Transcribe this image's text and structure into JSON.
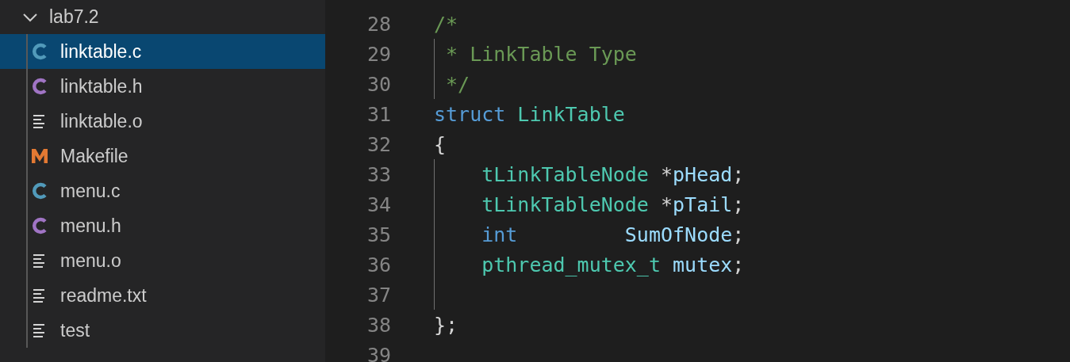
{
  "sidebar": {
    "folder": {
      "name": "lab7.2",
      "expanded": true
    },
    "items": [
      {
        "name": "linktable.c",
        "kind": "c",
        "selected": true
      },
      {
        "name": "linktable.h",
        "kind": "h",
        "selected": false
      },
      {
        "name": "linktable.o",
        "kind": "text",
        "selected": false
      },
      {
        "name": "Makefile",
        "kind": "make",
        "selected": false
      },
      {
        "name": "menu.c",
        "kind": "c",
        "selected": false
      },
      {
        "name": "menu.h",
        "kind": "h",
        "selected": false
      },
      {
        "name": "menu.o",
        "kind": "text",
        "selected": false
      },
      {
        "name": "readme.txt",
        "kind": "text",
        "selected": false
      },
      {
        "name": "test",
        "kind": "text",
        "selected": false
      }
    ]
  },
  "editor": {
    "lines": [
      {
        "number": "28",
        "indent_guide": false,
        "tokens": [
          {
            "text": "/*",
            "kind": "comment"
          }
        ]
      },
      {
        "number": "29",
        "indent_guide": true,
        "tokens": [
          {
            "text": " * LinkTable Type",
            "kind": "comment"
          }
        ]
      },
      {
        "number": "30",
        "indent_guide": true,
        "tokens": [
          {
            "text": " */",
            "kind": "comment"
          }
        ]
      },
      {
        "number": "31",
        "indent_guide": false,
        "tokens": [
          {
            "text": "struct",
            "kind": "keyword"
          },
          {
            "text": " LinkTable",
            "kind": "type"
          }
        ]
      },
      {
        "number": "32",
        "indent_guide": false,
        "tokens": [
          {
            "text": "{",
            "kind": "punct"
          }
        ]
      },
      {
        "number": "33",
        "indent_guide": true,
        "tokens": [
          {
            "text": "    tLinkTableNode",
            "kind": "type"
          },
          {
            "text": " *",
            "kind": "punct"
          },
          {
            "text": "pHead",
            "kind": "variable"
          },
          {
            "text": ";",
            "kind": "punct"
          }
        ]
      },
      {
        "number": "34",
        "indent_guide": true,
        "tokens": [
          {
            "text": "    tLinkTableNode",
            "kind": "type"
          },
          {
            "text": " *",
            "kind": "punct"
          },
          {
            "text": "pTail",
            "kind": "variable"
          },
          {
            "text": ";",
            "kind": "punct"
          }
        ]
      },
      {
        "number": "35",
        "indent_guide": true,
        "tokens": [
          {
            "text": "    int",
            "kind": "keyword"
          },
          {
            "text": "         SumOfNode",
            "kind": "variable"
          },
          {
            "text": ";",
            "kind": "punct"
          }
        ]
      },
      {
        "number": "36",
        "indent_guide": true,
        "tokens": [
          {
            "text": "    pthread_mutex_t",
            "kind": "type"
          },
          {
            "text": " mutex",
            "kind": "variable"
          },
          {
            "text": ";",
            "kind": "punct"
          }
        ]
      },
      {
        "number": "37",
        "indent_guide": true
      },
      {
        "number": "38",
        "indent_guide": false,
        "tokens": [
          {
            "text": "};",
            "kind": "punct"
          }
        ]
      },
      {
        "number": "39",
        "indent_guide": false
      }
    ]
  }
}
